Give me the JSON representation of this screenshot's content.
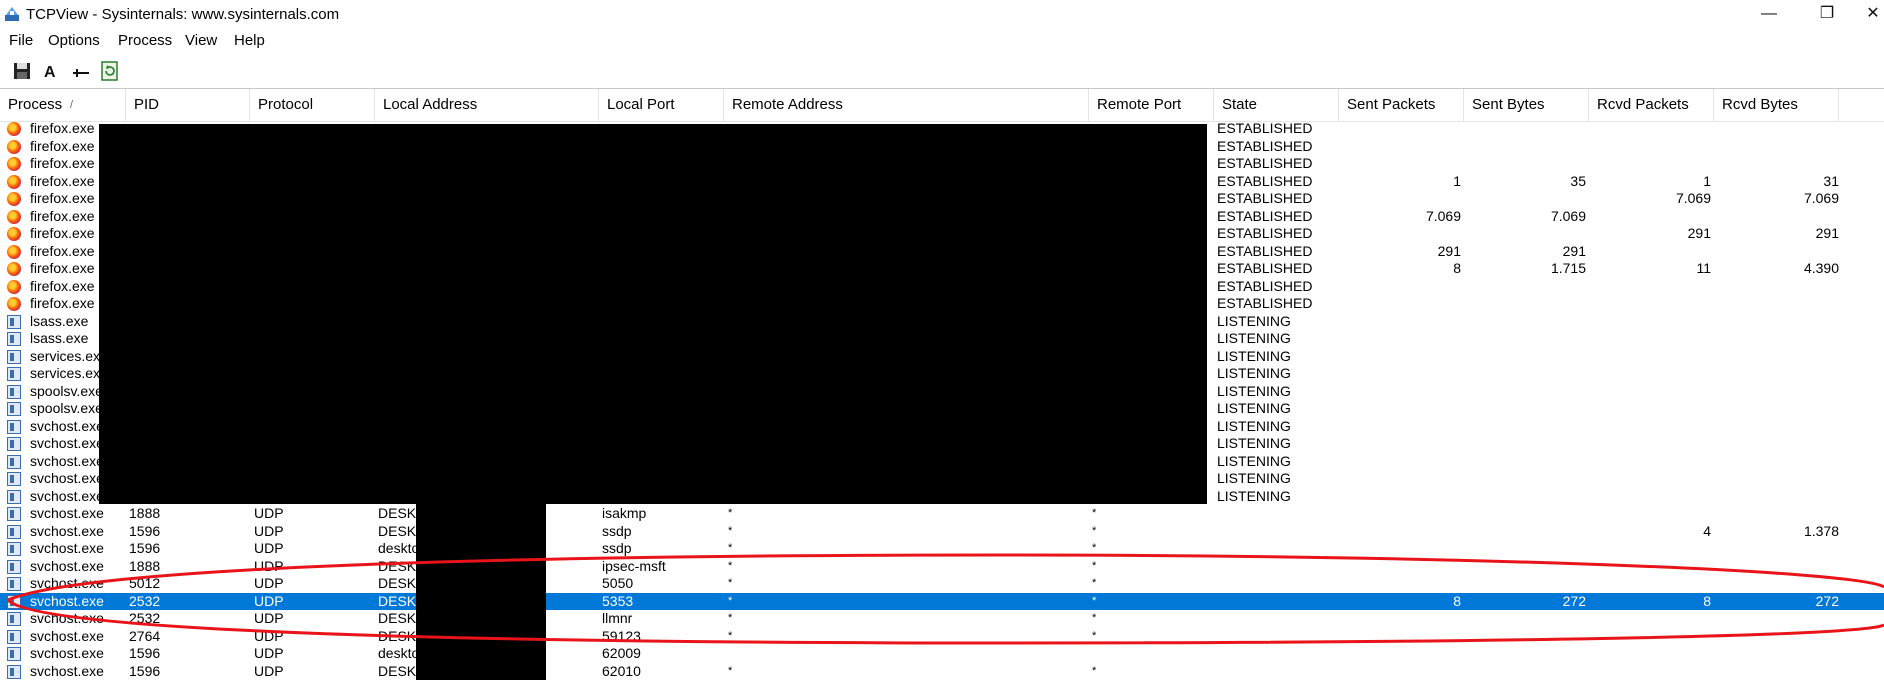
{
  "window": {
    "title": "TCPView - Sysinternals: www.sysinternals.com",
    "minimize": "—",
    "maximize": "❐",
    "close": "✕"
  },
  "menu": [
    "File",
    "Options",
    "Process",
    "View",
    "Help"
  ],
  "toolbar": {
    "save_icon": "floppy-disk",
    "font_icon": "A",
    "connector_icon": "connector",
    "refresh_icon": "refresh"
  },
  "columns": [
    "Process",
    "PID",
    "Protocol",
    "Local Address",
    "Local Port",
    "Remote Address",
    "Remote Port",
    "State",
    "Sent Packets",
    "Sent Bytes",
    "Rcvd Packets",
    "Rcvd Bytes"
  ],
  "sort_indicator": "/",
  "rows": [
    {
      "icon": "firefox",
      "process": "firefox.exe",
      "pid": "",
      "protocol": "",
      "local_address": "",
      "local_port": "",
      "remote_address": "",
      "remote_port": "",
      "state": "ESTABLISHED",
      "sent_packets": "",
      "sent_bytes": "",
      "rcvd_packets": "",
      "rcvd_bytes": ""
    },
    {
      "icon": "firefox",
      "process": "firefox.exe",
      "pid": "",
      "protocol": "",
      "local_address": "",
      "local_port": "",
      "remote_address": "",
      "remote_port": "",
      "state": "ESTABLISHED",
      "sent_packets": "",
      "sent_bytes": "",
      "rcvd_packets": "",
      "rcvd_bytes": ""
    },
    {
      "icon": "firefox",
      "process": "firefox.exe",
      "pid": "",
      "protocol": "",
      "local_address": "",
      "local_port": "",
      "remote_address": "",
      "remote_port": "",
      "state": "ESTABLISHED",
      "sent_packets": "",
      "sent_bytes": "",
      "rcvd_packets": "",
      "rcvd_bytes": ""
    },
    {
      "icon": "firefox",
      "process": "firefox.exe",
      "pid": "",
      "protocol": "",
      "local_address": "",
      "local_port": "",
      "remote_address": "",
      "remote_port": "",
      "state": "ESTABLISHED",
      "sent_packets": "1",
      "sent_bytes": "35",
      "rcvd_packets": "1",
      "rcvd_bytes": "31"
    },
    {
      "icon": "firefox",
      "process": "firefox.exe",
      "pid": "",
      "protocol": "",
      "local_address": "",
      "local_port": "",
      "remote_address": "",
      "remote_port": "",
      "state": "ESTABLISHED",
      "sent_packets": "",
      "sent_bytes": "",
      "rcvd_packets": "7.069",
      "rcvd_bytes": "7.069"
    },
    {
      "icon": "firefox",
      "process": "firefox.exe",
      "pid": "",
      "protocol": "",
      "local_address": "",
      "local_port": "",
      "remote_address": "",
      "remote_port": "",
      "state": "ESTABLISHED",
      "sent_packets": "7.069",
      "sent_bytes": "7.069",
      "rcvd_packets": "",
      "rcvd_bytes": ""
    },
    {
      "icon": "firefox",
      "process": "firefox.exe",
      "pid": "",
      "protocol": "",
      "local_address": "",
      "local_port": "",
      "remote_address": "",
      "remote_port": "",
      "state": "ESTABLISHED",
      "sent_packets": "",
      "sent_bytes": "",
      "rcvd_packets": "291",
      "rcvd_bytes": "291"
    },
    {
      "icon": "firefox",
      "process": "firefox.exe",
      "pid": "",
      "protocol": "",
      "local_address": "",
      "local_port": "",
      "remote_address": "",
      "remote_port": "",
      "state": "ESTABLISHED",
      "sent_packets": "291",
      "sent_bytes": "291",
      "rcvd_packets": "",
      "rcvd_bytes": ""
    },
    {
      "icon": "firefox",
      "process": "firefox.exe",
      "pid": "",
      "protocol": "",
      "local_address": "",
      "local_port": "",
      "remote_address": "",
      "remote_port": "",
      "state": "ESTABLISHED",
      "sent_packets": "8",
      "sent_bytes": "1.715",
      "rcvd_packets": "11",
      "rcvd_bytes": "4.390"
    },
    {
      "icon": "firefox",
      "process": "firefox.exe",
      "pid": "",
      "protocol": "",
      "local_address": "",
      "local_port": "",
      "remote_address": "",
      "remote_port": "",
      "state": "ESTABLISHED",
      "sent_packets": "",
      "sent_bytes": "",
      "rcvd_packets": "",
      "rcvd_bytes": ""
    },
    {
      "icon": "firefox",
      "process": "firefox.exe",
      "pid": "",
      "protocol": "",
      "local_address": "",
      "local_port": "",
      "remote_address": "",
      "remote_port": "",
      "state": "ESTABLISHED",
      "sent_packets": "",
      "sent_bytes": "",
      "rcvd_packets": "",
      "rcvd_bytes": ""
    },
    {
      "icon": "system",
      "process": "lsass.exe",
      "pid": "",
      "protocol": "",
      "local_address": "",
      "local_port": "",
      "remote_address": "",
      "remote_port": "",
      "state": "LISTENING",
      "sent_packets": "",
      "sent_bytes": "",
      "rcvd_packets": "",
      "rcvd_bytes": ""
    },
    {
      "icon": "system",
      "process": "lsass.exe",
      "pid": "",
      "protocol": "",
      "local_address": "",
      "local_port": "",
      "remote_address": "",
      "remote_port": "",
      "state": "LISTENING",
      "sent_packets": "",
      "sent_bytes": "",
      "rcvd_packets": "",
      "rcvd_bytes": ""
    },
    {
      "icon": "system",
      "process": "services.exe",
      "pid": "",
      "protocol": "",
      "local_address": "",
      "local_port": "",
      "remote_address": "",
      "remote_port": "",
      "state": "LISTENING",
      "sent_packets": "",
      "sent_bytes": "",
      "rcvd_packets": "",
      "rcvd_bytes": ""
    },
    {
      "icon": "system",
      "process": "services.exe",
      "pid": "",
      "protocol": "",
      "local_address": "",
      "local_port": "",
      "remote_address": "",
      "remote_port": "",
      "state": "LISTENING",
      "sent_packets": "",
      "sent_bytes": "",
      "rcvd_packets": "",
      "rcvd_bytes": ""
    },
    {
      "icon": "system",
      "process": "spoolsv.exe",
      "pid": "",
      "protocol": "",
      "local_address": "",
      "local_port": "",
      "remote_address": "",
      "remote_port": "",
      "state": "LISTENING",
      "sent_packets": "",
      "sent_bytes": "",
      "rcvd_packets": "",
      "rcvd_bytes": ""
    },
    {
      "icon": "system",
      "process": "spoolsv.exe",
      "pid": "",
      "protocol": "",
      "local_address": "",
      "local_port": "",
      "remote_address": "",
      "remote_port": "",
      "state": "LISTENING",
      "sent_packets": "",
      "sent_bytes": "",
      "rcvd_packets": "",
      "rcvd_bytes": ""
    },
    {
      "icon": "svchost",
      "process": "svchost.exe",
      "pid": "",
      "protocol": "",
      "local_address": "",
      "local_port": "",
      "remote_address": "",
      "remote_port": "",
      "state": "LISTENING",
      "sent_packets": "",
      "sent_bytes": "",
      "rcvd_packets": "",
      "rcvd_bytes": ""
    },
    {
      "icon": "svchost",
      "process": "svchost.exe",
      "pid": "",
      "protocol": "",
      "local_address": "",
      "local_port": "",
      "remote_address": "",
      "remote_port": "",
      "state": "LISTENING",
      "sent_packets": "",
      "sent_bytes": "",
      "rcvd_packets": "",
      "rcvd_bytes": ""
    },
    {
      "icon": "svchost",
      "process": "svchost.exe",
      "pid": "",
      "protocol": "",
      "local_address": "",
      "local_port": "",
      "remote_address": "",
      "remote_port": "",
      "state": "LISTENING",
      "sent_packets": "",
      "sent_bytes": "",
      "rcvd_packets": "",
      "rcvd_bytes": ""
    },
    {
      "icon": "svchost",
      "process": "svchost.exe",
      "pid": "",
      "protocol": "",
      "local_address": "",
      "local_port": "",
      "remote_address": "",
      "remote_port": "",
      "state": "LISTENING",
      "sent_packets": "",
      "sent_bytes": "",
      "rcvd_packets": "",
      "rcvd_bytes": ""
    },
    {
      "icon": "svchost",
      "process": "svchost.exe",
      "pid": "",
      "protocol": "",
      "local_address": "",
      "local_port": "",
      "remote_address": "",
      "remote_port": "",
      "state": "LISTENING",
      "sent_packets": "",
      "sent_bytes": "",
      "rcvd_packets": "",
      "rcvd_bytes": ""
    },
    {
      "icon": "svchost",
      "process": "svchost.exe",
      "pid": "1888",
      "protocol": "UDP",
      "local_address": "DESK",
      "local_port": "isakmp",
      "remote_address": "*",
      "remote_port": "*",
      "state": "",
      "sent_packets": "",
      "sent_bytes": "",
      "rcvd_packets": "",
      "rcvd_bytes": ""
    },
    {
      "icon": "svchost",
      "process": "svchost.exe",
      "pid": "1596",
      "protocol": "UDP",
      "local_address": "DESK",
      "local_port": "ssdp",
      "remote_address": "*",
      "remote_port": "*",
      "state": "",
      "sent_packets": "",
      "sent_bytes": "",
      "rcvd_packets": "4",
      "rcvd_bytes": "1.378"
    },
    {
      "icon": "svchost",
      "process": "svchost.exe",
      "pid": "1596",
      "protocol": "UDP",
      "local_address": "deskto",
      "local_port": "ssdp",
      "remote_address": "*",
      "remote_port": "*",
      "state": "",
      "sent_packets": "",
      "sent_bytes": "",
      "rcvd_packets": "",
      "rcvd_bytes": ""
    },
    {
      "icon": "svchost",
      "process": "svchost.exe",
      "pid": "1888",
      "protocol": "UDP",
      "local_address": "DESK",
      "local_port": "ipsec-msft",
      "remote_address": "*",
      "remote_port": "*",
      "state": "",
      "sent_packets": "",
      "sent_bytes": "",
      "rcvd_packets": "",
      "rcvd_bytes": ""
    },
    {
      "icon": "svchost",
      "process": "svchost.exe",
      "pid": "5012",
      "protocol": "UDP",
      "local_address": "DESK",
      "local_port": "5050",
      "remote_address": "*",
      "remote_port": "*",
      "state": "",
      "sent_packets": "",
      "sent_bytes": "",
      "rcvd_packets": "",
      "rcvd_bytes": ""
    },
    {
      "icon": "svchost",
      "process": "svchost.exe",
      "pid": "2532",
      "protocol": "UDP",
      "local_address": "DESK",
      "local_port": "5353",
      "remote_address": "*",
      "remote_port": "*",
      "state": "",
      "sent_packets": "8",
      "sent_bytes": "272",
      "rcvd_packets": "8",
      "rcvd_bytes": "272",
      "selected": true
    },
    {
      "icon": "svchost",
      "process": "svchost.exe",
      "pid": "2532",
      "protocol": "UDP",
      "local_address": "DESK",
      "local_port": "llmnr",
      "remote_address": "*",
      "remote_port": "*",
      "state": "",
      "sent_packets": "",
      "sent_bytes": "",
      "rcvd_packets": "",
      "rcvd_bytes": ""
    },
    {
      "icon": "svchost",
      "process": "svchost.exe",
      "pid": "2764",
      "protocol": "UDP",
      "local_address": "DESK",
      "local_port": "59123",
      "remote_address": "*",
      "remote_port": "*",
      "state": "",
      "sent_packets": "",
      "sent_bytes": "",
      "rcvd_packets": "",
      "rcvd_bytes": ""
    },
    {
      "icon": "svchost",
      "process": "svchost.exe",
      "pid": "1596",
      "protocol": "UDP",
      "local_address": "deskto",
      "local_port": "62009",
      "remote_address": "",
      "remote_port": "",
      "state": "",
      "sent_packets": "",
      "sent_bytes": "",
      "rcvd_packets": "",
      "rcvd_bytes": ""
    },
    {
      "icon": "svchost",
      "process": "svchost.exe",
      "pid": "1596",
      "protocol": "UDP",
      "local_address": "DESK",
      "local_port": "62010",
      "remote_address": "*",
      "remote_port": "*",
      "state": "",
      "sent_packets": "",
      "sent_bytes": "",
      "rcvd_packets": "",
      "rcvd_bytes": ""
    }
  ],
  "colors": {
    "selection": "#0078d7",
    "annotation": "#e8141a",
    "redaction": "#000000"
  }
}
